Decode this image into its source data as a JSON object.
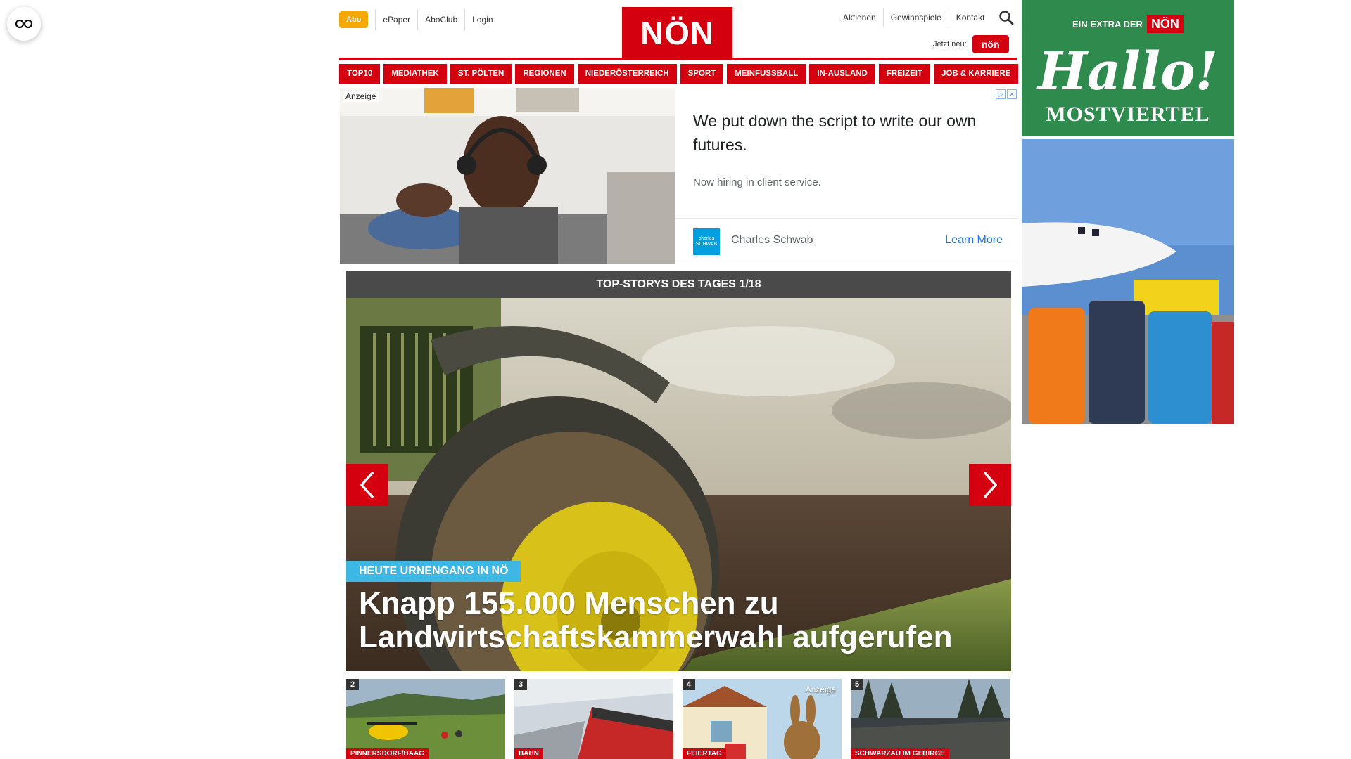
{
  "header": {
    "abo_label": "Abo",
    "top_links": [
      "ePaper",
      "AboClub",
      "Login"
    ],
    "logo_text": "NÖN",
    "right_links": [
      "Aktionen",
      "Gewinnspiele",
      "Kontakt"
    ],
    "jetzt_label": "Jetzt neu:",
    "jetzt_badge": "nön"
  },
  "nav": {
    "items": [
      "TOP10",
      "MEDIATHEK",
      "ST. PÖLTEN",
      "REGIONEN",
      "NIEDERÖSTERREICH",
      "SPORT",
      "MEINFUSSBALL",
      "IN-AUSLAND",
      "FREIZEIT",
      "JOB & KARRIERE"
    ]
  },
  "ad": {
    "tag": "Anzeige",
    "headline": "We put down the script to write our own futures.",
    "subline": "Now hiring in client service.",
    "brand_logo_text": "charles SCHWAB",
    "brand": "Charles Schwab",
    "cta": "Learn More"
  },
  "top_story": {
    "bar_title": "TOP-STORYS DES TAGES 1/18",
    "kicker": "HEUTE URNENGANG IN NÖ",
    "title": "Knapp 155.000 Menschen zu Landwirtschaftskammerwahl aufgerufen"
  },
  "thumbs": [
    {
      "num": "2",
      "category": "PINNERSDORF/HAAG",
      "anzeige": ""
    },
    {
      "num": "3",
      "category": "BAHN",
      "anzeige": ""
    },
    {
      "num": "4",
      "category": "FEIERTAG",
      "anzeige": "Anzeige"
    },
    {
      "num": "5",
      "category": "SCHWARZAU IM GEBIRGE",
      "anzeige": ""
    }
  ],
  "sidebar": {
    "extra_label": "EIN EXTRA DER",
    "extra_brand": "NÖN",
    "hallo": "Hallo!",
    "region": "MOSTVIERTEL"
  },
  "colors": {
    "brand_red": "#d40010",
    "abo_orange": "#f5a800",
    "kicker_blue": "#3db7e4",
    "sidebar_green": "#2f8a4d"
  }
}
